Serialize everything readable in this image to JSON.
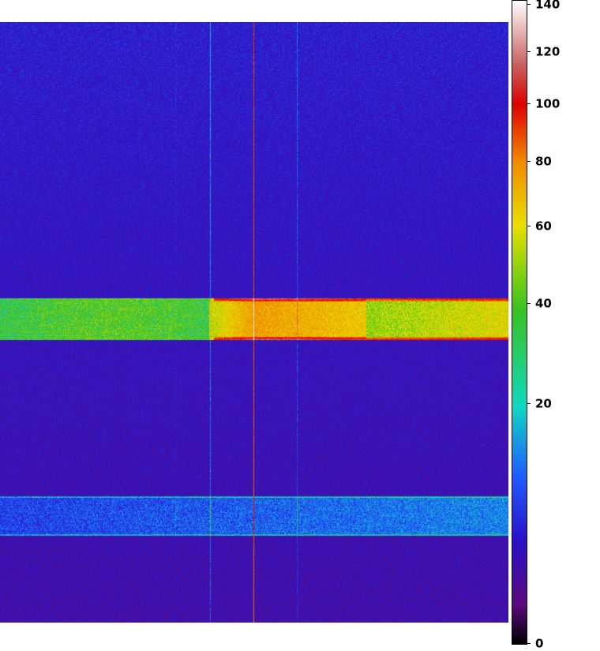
{
  "colorbar": {
    "ticks": [
      {
        "value": 140,
        "label": "140"
      },
      {
        "value": 120,
        "label": "120"
      },
      {
        "value": 100,
        "label": "100"
      },
      {
        "value": 80,
        "label": "80"
      },
      {
        "value": 60,
        "label": "60"
      },
      {
        "value": 40,
        "label": "40"
      },
      {
        "value": 20,
        "label": "20"
      },
      {
        "value": 0,
        "label": "0"
      }
    ],
    "range": [
      0,
      140
    ],
    "colors": [
      "#000000",
      "#5a0a7a",
      "#2a10c8",
      "#1f5cff",
      "#10d8c0",
      "#39c21f",
      "#e8e000",
      "#f08a00",
      "#dd0000",
      "#ffffff"
    ]
  },
  "image": {
    "background_color": "#3820c0",
    "features": {
      "upper_band": "bright horizontal band, green on the left to orange/red/white on the right",
      "lower_band": "faint blue horizontal band",
      "vertical_lines": [
        "cyan",
        "red/yellow",
        "cyan"
      ]
    }
  }
}
